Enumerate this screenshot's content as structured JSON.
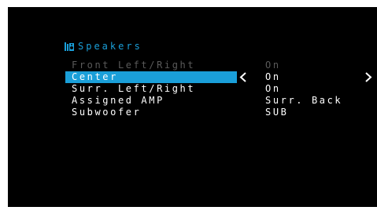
{
  "menu": {
    "title": "Speakers",
    "title_icon": "speaker-icon",
    "accent_color": "#1a9fd9",
    "items": [
      {
        "label": "Front Left/Right",
        "value": "On",
        "state": "disabled"
      },
      {
        "label": "Center",
        "value": "On",
        "state": "selected"
      },
      {
        "label": "Surr. Left/Right",
        "value": "On",
        "state": "normal"
      },
      {
        "label": "Assigned AMP",
        "value": "Surr. Back",
        "state": "normal"
      },
      {
        "label": "Subwoofer",
        "value": "SUB",
        "state": "normal"
      }
    ],
    "left_arrow_icon": "chevron-left-icon",
    "right_arrow_icon": "chevron-right-icon"
  }
}
